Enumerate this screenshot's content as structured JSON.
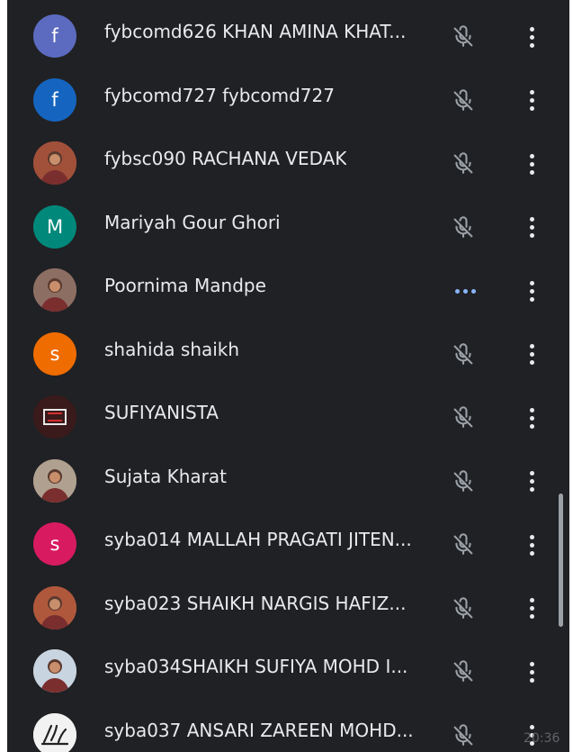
{
  "participants": [
    {
      "name": "fybcomd626 KHAN AMINA KHAT...",
      "avatar": {
        "type": "letter",
        "letter": "f",
        "color": "#5c6bc0"
      },
      "status": "muted"
    },
    {
      "name": "fybcomd727 fybcomd727",
      "avatar": {
        "type": "letter",
        "letter": "f",
        "color": "#1565c0"
      },
      "status": "muted"
    },
    {
      "name": "fybsc090 RACHANA VEDAK",
      "avatar": {
        "type": "photo",
        "icon": "profile-photo-icon",
        "color": "#a1503a"
      },
      "status": "muted"
    },
    {
      "name": "Mariyah Gour Ghori",
      "avatar": {
        "type": "letter",
        "letter": "M",
        "color": "#00897b"
      },
      "status": "muted"
    },
    {
      "name": "Poornima Mandpe",
      "avatar": {
        "type": "photo",
        "icon": "profile-photo-icon",
        "color": "#8d6e63"
      },
      "status": "speaking"
    },
    {
      "name": "shahida shaikh",
      "avatar": {
        "type": "letter",
        "letter": "s",
        "color": "#ef6c00"
      },
      "status": "muted"
    },
    {
      "name": "SUFIYANISTA",
      "avatar": {
        "type": "photo",
        "icon": "logo-photo-icon",
        "color": "#3a1a1a"
      },
      "status": "muted"
    },
    {
      "name": "Sujata Kharat",
      "avatar": {
        "type": "photo",
        "icon": "profile-photo-icon",
        "color": "#b0a090"
      },
      "status": "muted"
    },
    {
      "name": "syba014 MALLAH PRAGATI JITEN...",
      "avatar": {
        "type": "letter",
        "letter": "s",
        "color": "#d81b60"
      },
      "status": "muted"
    },
    {
      "name": "syba023 SHAIKH NARGIS HAFIZ...",
      "avatar": {
        "type": "photo",
        "icon": "profile-photo-icon",
        "color": "#b0583c"
      },
      "status": "muted"
    },
    {
      "name": "syba034SHAIKH SUFIYA MOHD I...",
      "avatar": {
        "type": "photo",
        "icon": "profile-photo-icon",
        "color": "#c8d4e0"
      },
      "status": "muted"
    },
    {
      "name": "syba037 ANSARI ZAREEN MOHD...",
      "avatar": {
        "type": "photo",
        "icon": "calligraphy-photo-icon",
        "color": "#f2f2f2"
      },
      "status": "muted"
    }
  ],
  "clock": "20:36",
  "colors": {
    "background": "#202124",
    "text": "#e8eaed",
    "icon": "#9aa0a6",
    "speaking": "#8ab4f8"
  }
}
